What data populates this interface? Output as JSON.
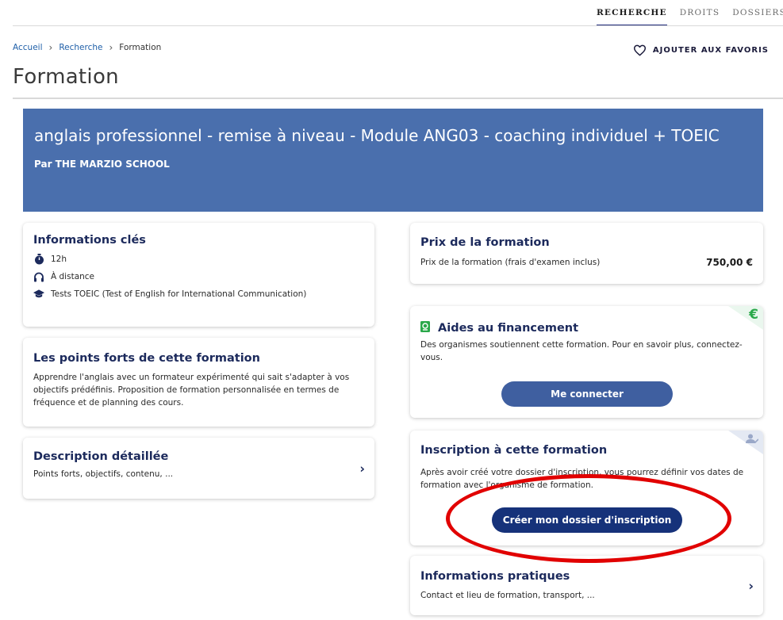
{
  "topnav": {
    "items": [
      {
        "label": "RECHERCHE",
        "active": true
      },
      {
        "label": "DROITS",
        "active": false
      },
      {
        "label": "DOSSIERS",
        "active": false
      }
    ]
  },
  "breadcrumb": {
    "home": "Accueil",
    "search": "Recherche",
    "current": "Formation"
  },
  "favorite": {
    "label": "AJOUTER AUX FAVORIS",
    "icon": "heart-outline-icon"
  },
  "page_title": "Formation",
  "hero": {
    "title": "anglais professionnel - remise à niveau - Module ANG03 - coaching individuel + TOEIC",
    "by": "Par THE MARZIO SCHOOL",
    "bg_color": "#4a6fad"
  },
  "key_info": {
    "title": "Informations clés",
    "duration": "12h",
    "mode": "À distance",
    "certification": "Tests TOEIC (Test of English for International Communication)"
  },
  "strengths": {
    "title": "Les points forts de cette formation",
    "text": "Apprendre l'anglais avec un formateur expérimenté qui sait s'adapter à vos objectifs prédéfinis. Proposition de formation personnalisée en termes de fréquence et de planning des cours."
  },
  "description": {
    "title": "Description détaillée",
    "subtitle": "Points forts, objectifs, contenu, ..."
  },
  "price": {
    "title": "Prix de la formation",
    "label": "Prix de la formation (frais d'examen inclus)",
    "value": "750,00 €"
  },
  "funding": {
    "title": "Aides au financement",
    "text": "Des organismes soutiennent cette formation. Pour en savoir plus, connectez-vous.",
    "button": "Me connecter",
    "corner_symbol": "€"
  },
  "registration": {
    "title": "Inscription à cette formation",
    "text": "Après avoir créé votre dossier d'inscription, vous pourrez définir vos dates de formation avec l'organisme de formation.",
    "button": "Créer mon dossier d'inscription"
  },
  "practical": {
    "title": "Informations pratiques",
    "subtitle": "Contact et lieu de formation, transport, ..."
  },
  "colors": {
    "accent": "#1c2a5c",
    "button": "#3f5fa0",
    "button_dark": "#16327a",
    "highlight": "#e10000",
    "link": "#1f5fa8"
  }
}
